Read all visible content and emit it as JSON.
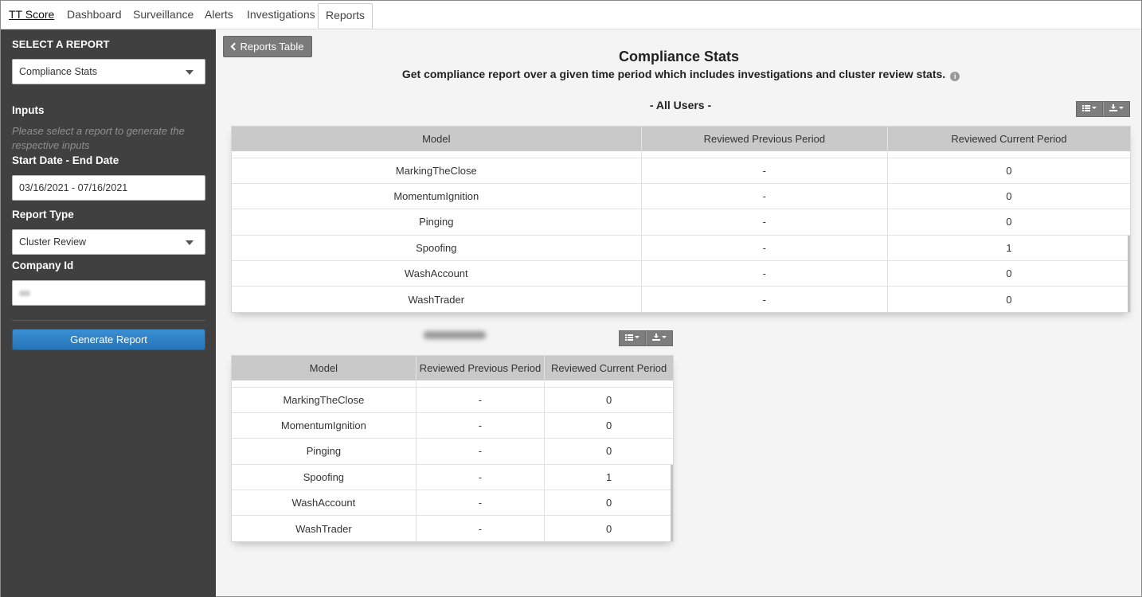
{
  "nav": {
    "brand": "TT Score",
    "tabs": [
      "Dashboard",
      "Surveillance",
      "Alerts",
      "Investigations",
      "Reports"
    ],
    "active_tab": "Reports"
  },
  "sidebar": {
    "heading": "SELECT A REPORT",
    "report_select": "Compliance Stats",
    "inputs_label": "Inputs",
    "inputs_hint": "Please select a report to generate the respective inputs",
    "date_label": "Start Date - End Date",
    "date_value": "03/16/2021 - 07/16/2021",
    "report_type_label": "Report Type",
    "report_type_value": "Cluster Review",
    "company_label": "Company Id",
    "generate_button": "Generate Report"
  },
  "main": {
    "back_button": "Reports Table",
    "title": "Compliance Stats",
    "subtitle": "Get compliance report over a given time period which includes investigations and cluster review stats.",
    "info_icon": "i",
    "all_users_title": "- All Users -",
    "columns": [
      "Model",
      "Reviewed Previous Period",
      "Reviewed Current Period"
    ],
    "all_users_rows": [
      [
        "MarkingTheClose",
        "-",
        "0"
      ],
      [
        "MomentumIgnition",
        "-",
        "0"
      ],
      [
        "Pinging",
        "-",
        "0"
      ],
      [
        "Spoofing",
        "-",
        "1"
      ],
      [
        "WashAccount",
        "-",
        "0"
      ],
      [
        "WashTrader",
        "-",
        "0"
      ]
    ],
    "user_rows": [
      [
        "MarkingTheClose",
        "-",
        "0"
      ],
      [
        "MomentumIgnition",
        "-",
        "0"
      ],
      [
        "Pinging",
        "-",
        "0"
      ],
      [
        "Spoofing",
        "-",
        "1"
      ],
      [
        "WashAccount",
        "-",
        "0"
      ],
      [
        "WashTrader",
        "-",
        "0"
      ]
    ]
  }
}
